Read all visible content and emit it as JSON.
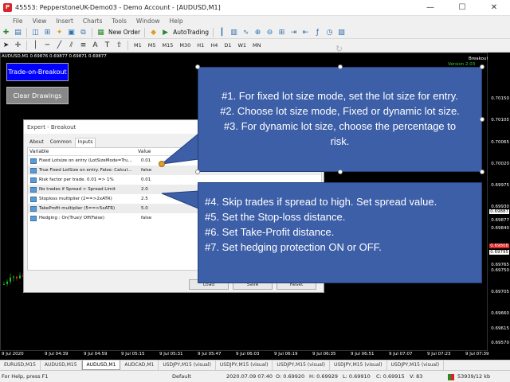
{
  "window": {
    "title": "45553: PepperstoneUK-Demo03 - Demo Account - [AUDUSD,M1]",
    "controls": [
      "—",
      "☐",
      "✕"
    ]
  },
  "menu": [
    "File",
    "View",
    "Insert",
    "Charts",
    "Tools",
    "Window",
    "Help"
  ],
  "toolbar": {
    "new_order": "New Order",
    "autotrading": "AutoTrading",
    "timeframes": [
      "M1",
      "M5",
      "M15",
      "M30",
      "H1",
      "H4",
      "D1",
      "W1",
      "MN"
    ]
  },
  "chart": {
    "symbol_label": "AUDUSD,M1  0.69876 0.69877 0.69871 0.69877",
    "ea_label": "Breakout",
    "version_label": "Version  2.03",
    "buttons": {
      "trade": "Trade-on-Breakout",
      "clear": "Clear Drawings"
    },
    "prices": [
      "0.70150",
      "0.70105",
      "0.70065",
      "0.70020",
      "0.69975",
      "0.69930",
      "0.69887",
      "0.69877",
      "0.69840",
      "0.69808",
      "0.69795",
      "0.69765",
      "0.69750",
      "0.69705",
      "0.69660",
      "0.69615",
      "0.69570"
    ],
    "times": [
      "9 Jul 2020",
      "9 Jul 04:39",
      "9 Jul 04:59",
      "9 Jul 05:15",
      "9 Jul 05:31",
      "9 Jul 05:47",
      "9 Jul 06:03",
      "9 Jul 06:19",
      "9 Jul 06:35",
      "9 Jul 06:51",
      "9 Jul 07:07",
      "9 Jul 07:23",
      "9 Jul 07:39"
    ]
  },
  "dialog": {
    "title": "Expert - Breakout",
    "tabs": [
      "About",
      "Common",
      "Inputs"
    ],
    "col_variable": "Variable",
    "col_value": "Value",
    "rows": [
      {
        "name": "Fixed Lotsize on entry (LotSizeMode=Tru...",
        "value": "0.01"
      },
      {
        "name": "True Fixed LotSize on entry. False: Calcul...",
        "value": "false"
      },
      {
        "name": "Risk factor per trade. 0.01 => 1%",
        "value": "0.01"
      },
      {
        "name": "No trades if Spread > Spread Limit",
        "value": "2.0"
      },
      {
        "name": "Stoploss multiplier (2==>2xATR)",
        "value": "2.5"
      },
      {
        "name": "TakeProfit multiplier (5==>5xATR)",
        "value": "5.0"
      },
      {
        "name": "Hedging : On(True)/ Off(False)",
        "value": "false"
      }
    ],
    "buttons": [
      "Load",
      "Save",
      "Reset"
    ]
  },
  "callout1": [
    "#1. For fixed lot size mode, set the lot size for entry.",
    "#2. Choose lot size mode, Fixed or dynamic lot size.",
    "#3. For dynamic lot size, choose the percentage to",
    "risk."
  ],
  "callout2": [
    "#4. Skip trades if spread to high. Set spread value.",
    "#5. Set the Stop-loss distance.",
    "#6. Set Take-Profit distance.",
    "#7. Set hedging protection ON or OFF."
  ],
  "symbol_tabs": [
    "EURUSD,M15",
    "AUDUSD,M15",
    "AUDUSD,M1",
    "AUDCAD,M1",
    "USDJPY,M15 (visual)",
    "USDJPY,M15 (visual)",
    "USDJPY,M15 (visual)",
    "USDJPY,M15 (visual)",
    "USDJPY,M15 (visual)"
  ],
  "status": {
    "help": "For Help, press F1",
    "profile": "Default",
    "datetime": "2020.07.09 07:40",
    "open": "O: 0.69920",
    "high": "H: 0.69929",
    "low": "L: 0.69910",
    "close": "C: 0.69915",
    "volume": "V: 83",
    "traffic": "53939/12 kb"
  }
}
